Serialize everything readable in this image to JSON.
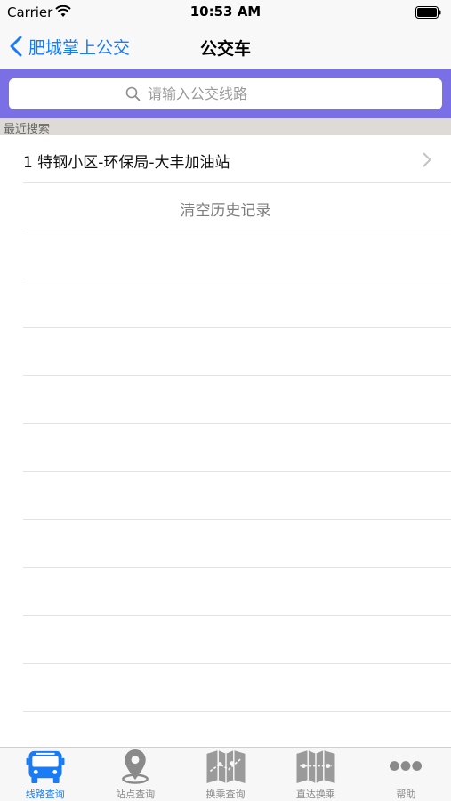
{
  "status_bar": {
    "carrier": "Carrier",
    "time": "10:53 AM"
  },
  "nav": {
    "back_label": "肥城掌上公交",
    "title": "公交车"
  },
  "search": {
    "placeholder": "请输入公交线路"
  },
  "recent": {
    "header": "最近搜索",
    "items": [
      {
        "label": "1 特钢小区-环保局-大丰加油站"
      }
    ],
    "clear_label": "清空历史记录"
  },
  "tabs": [
    {
      "label": "线路查询",
      "icon": "bus-icon",
      "active": true
    },
    {
      "label": "站点查询",
      "icon": "location-pin-icon",
      "active": false
    },
    {
      "label": "换乘查询",
      "icon": "map-icon",
      "active": false
    },
    {
      "label": "直达换乘",
      "icon": "map-icon",
      "active": false
    },
    {
      "label": "帮助",
      "icon": "more-dots-icon",
      "active": false
    }
  ],
  "colors": {
    "accent": "#1a7cf5",
    "search_bar_bg": "#7b6fe6",
    "section_header_bg": "#dedbd6",
    "inactive_tab": "#8a8a8a"
  }
}
